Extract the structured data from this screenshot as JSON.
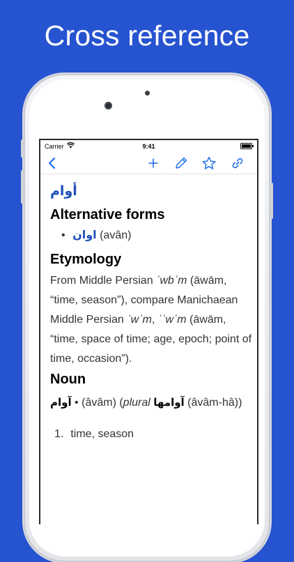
{
  "headline": "Cross reference",
  "status_bar": {
    "carrier": "Carrier",
    "time": "9:41"
  },
  "nav": {
    "icons": [
      "back-chevron-icon",
      "plus-icon",
      "pencil-icon",
      "star-icon",
      "link-icon"
    ],
    "accent_color": "#1f6feb"
  },
  "entry": {
    "headword": "أوام",
    "sections": {
      "alternative_forms": {
        "heading": "Alternative forms",
        "items": [
          {
            "arabic": "اوان",
            "translit": "(avân)"
          }
        ]
      },
      "etymology": {
        "heading": "Etymology",
        "text_pre": "From Middle Persian ",
        "term1": "ʾwbʾm",
        "text_mid1": " (āwām, “time, season”), compare Manichaean Middle Persian ",
        "term2": "ʾwʾm",
        "text_mid2": ", ",
        "term3": "ʾʾwʾm",
        "text_post": " (āwām, “time, space of time; age, epoch; point of time, occasion”)."
      },
      "noun": {
        "heading": "Noun",
        "form": "آوام",
        "sep": " • ",
        "translit": "(âvâm)",
        "open_paren": " (",
        "plural_label": "plural",
        "plural_form": "آوامها",
        "plural_translit": "(âvâm-hâ))",
        "senses": [
          {
            "num": "1.",
            "text": "time, season"
          }
        ]
      }
    }
  },
  "colors": {
    "background": "#2653d0",
    "link_blue": "#1f4fb8"
  }
}
